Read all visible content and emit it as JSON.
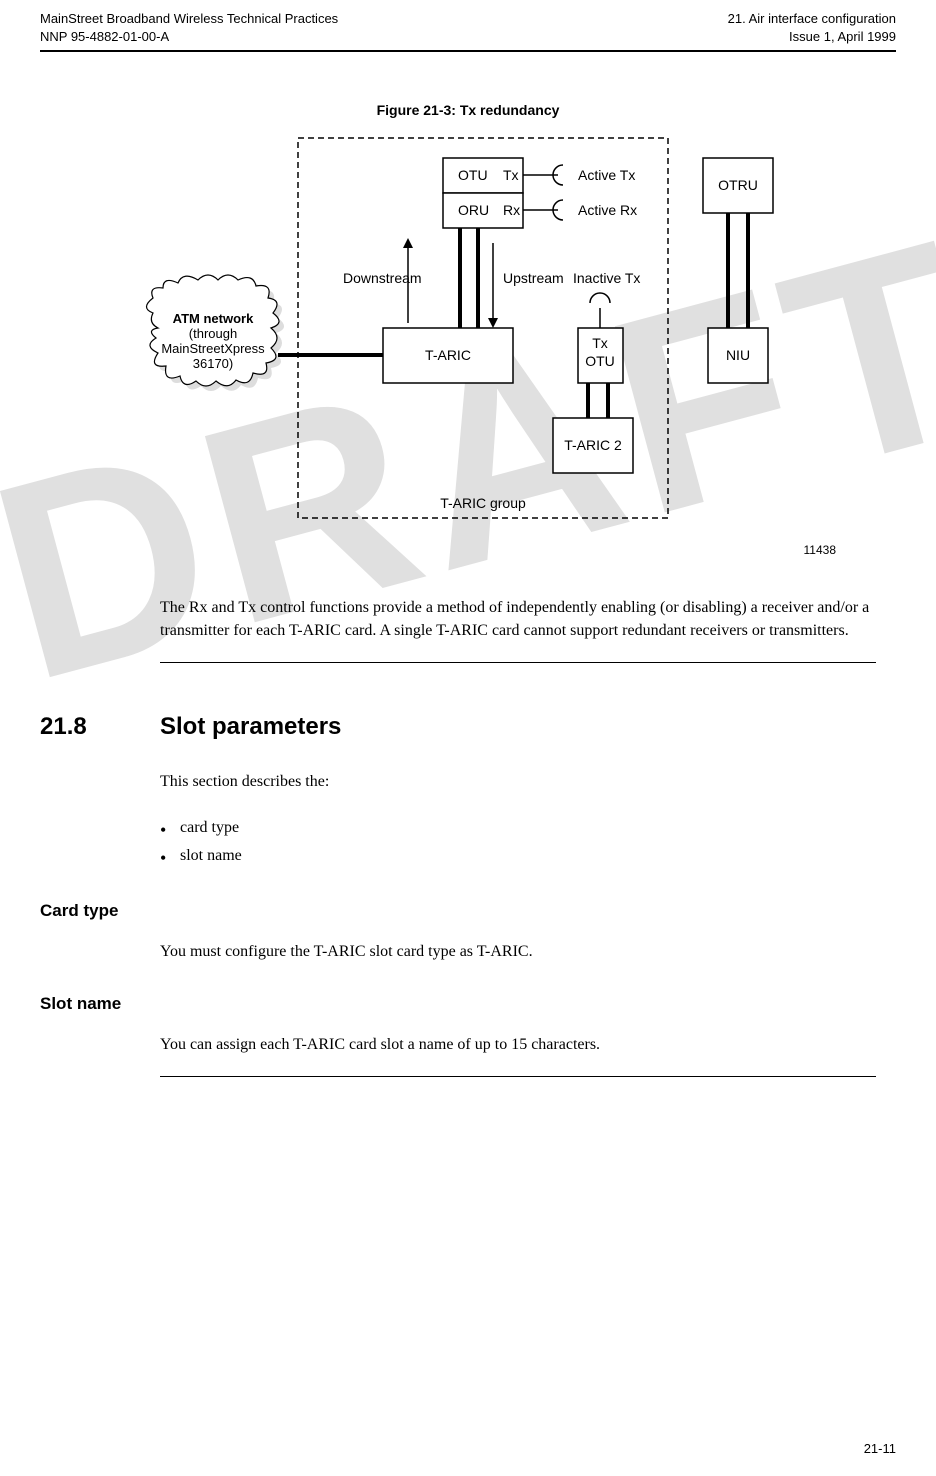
{
  "header": {
    "left1": "MainStreet Broadband Wireless Technical Practices",
    "left2": "NNP 95-4882-01-00-A",
    "right1": "21. Air interface configuration",
    "right2": "Issue 1, April 1999"
  },
  "watermark": "DRAFT",
  "figure": {
    "title": "Figure 21-3:  Tx redundancy",
    "id": "11438",
    "labels": {
      "otu": "OTU",
      "tx": "Tx",
      "oru": "ORU",
      "rx": "Rx",
      "active_tx": "Active Tx",
      "active_rx": "Active Rx",
      "downstream": "Downstream",
      "upstream": "Upstream",
      "inactive_tx": "Inactive Tx",
      "taric": "T-ARIC",
      "taric2": "T-ARIC 2",
      "taric_group": "T-ARIC group",
      "otru": "OTRU",
      "niu": "NIU",
      "atm1": "ATM network",
      "atm2": "(through",
      "atm3": "MainStreetXpress",
      "atm4": "36170)"
    }
  },
  "para1": "The Rx and Tx control functions provide a method of independently enabling (or disabling) a receiver and/or a transmitter for each T-ARIC card. A single T-ARIC card cannot support redundant receivers or transmitters.",
  "section": {
    "num": "21.8",
    "title": "Slot parameters"
  },
  "intro": "This section describes the:",
  "bullets": [
    "card type",
    "slot name"
  ],
  "sub1": {
    "title": "Card type",
    "body": "You must configure the T-ARIC slot card type as T-ARIC."
  },
  "sub2": {
    "title": "Slot name",
    "body": "You can assign each T-ARIC card slot a name of up to 15 characters."
  },
  "footer": "21-11"
}
